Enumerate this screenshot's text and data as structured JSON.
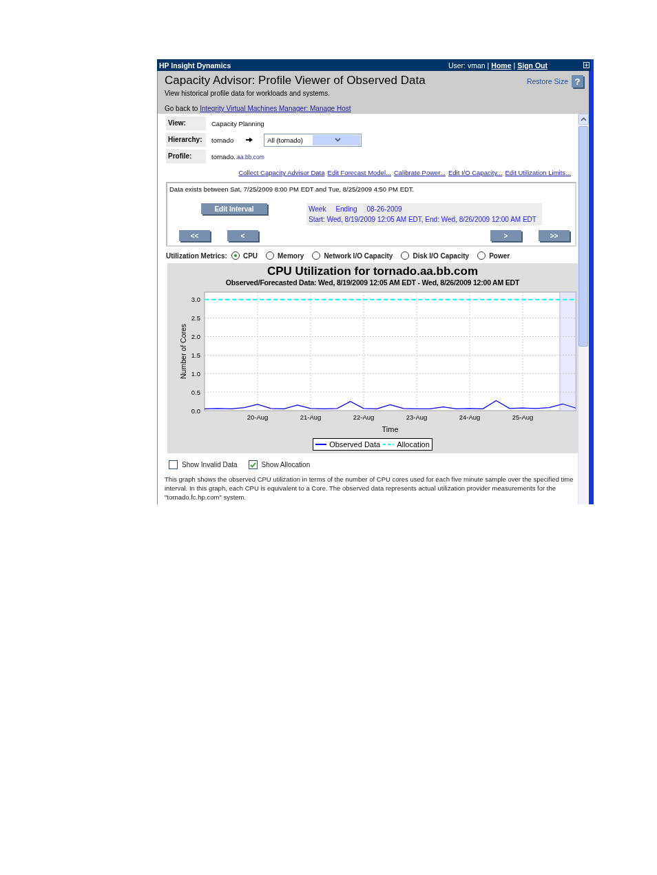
{
  "title_bar": {
    "app_name": "HP Insight Dynamics",
    "user": "User: vman",
    "links": [
      "Home",
      "Sign Out"
    ],
    "separator": "|"
  },
  "header": {
    "title": "Capacity Advisor: Profile Viewer of Observed Data",
    "subtitle": "View historical profile data for workloads and systems.",
    "restore_size": "Restore Size",
    "help": "?",
    "back_prefix": "Go back to",
    "back_link": "Integrity Virtual Machines Manager: Manage Host"
  },
  "properties": [
    {
      "kind": "text",
      "label": "View:",
      "value": "Capacity Planning"
    },
    {
      "kind": "hierarchy",
      "label": "Hierarchy:",
      "value": "tornado",
      "select_value": "All (tornado)"
    },
    {
      "kind": "profile",
      "label": "Profile:",
      "value": "tornado.",
      "value_suffix": ".aa.bb.com"
    }
  ],
  "actions": [
    "Collect Capacity Advisor Data",
    "Edit Forecast Model...",
    "Calibrate Power...",
    "Edit I/O Capacity...",
    "Edit Utilization Limits..."
  ],
  "interval": {
    "data_range": "Data exists between Sat, 7/25/2009 8:00 PM EDT and Tue, 8/25/2009 4:50 PM EDT.",
    "edit_button": "Edit Interval",
    "period": "Week",
    "ending_label": "Ending",
    "ending": "08-26-2009",
    "range": "Start: Wed, 8/19/2009 12:05 AM EDT, End: Wed, 8/26/2009 12:00 AM EDT",
    "nav_buttons": [
      "<<",
      "<",
      ">",
      ">>"
    ]
  },
  "metrics": {
    "label": "Utilization Metrics:",
    "options": [
      {
        "label": "CPU",
        "selected": true
      },
      {
        "label": "Memory",
        "selected": false
      },
      {
        "label": "Network I/O Capacity",
        "selected": false
      },
      {
        "label": "Disk I/O Capacity",
        "selected": false
      },
      {
        "label": "Power",
        "selected": false
      }
    ]
  },
  "chart": {
    "subtitle": "Observed/Forecasted Data: Wed, 8/19/2009 12:05 AM EDT - Wed, 8/26/2009 12:00 AM EDT",
    "chart_data": {
      "type": "line",
      "title": "CPU Utilization for tornado.aa.bb.com",
      "xlabel": "Time",
      "ylabel": "Number of Cores",
      "categories": [
        null,
        null,
        null,
        null,
        "20-Aug",
        null,
        null,
        null,
        "21-Aug",
        null,
        null,
        null,
        "22-Aug",
        null,
        null,
        null,
        "23-Aug",
        null,
        null,
        null,
        "24-Aug",
        null,
        null,
        null,
        "25-Aug",
        null,
        null,
        null,
        null
      ],
      "series": [
        {
          "name": "Observed Data",
          "color": "#0000ff",
          "line_style": "solid",
          "values": [
            0.05,
            0.06,
            0.05,
            0.08,
            0.17,
            0.06,
            0.05,
            0.15,
            0.06,
            0.05,
            0.06,
            0.25,
            0.06,
            0.05,
            0.16,
            0.06,
            0.05,
            0.05,
            0.1,
            0.05,
            0.06,
            0.05,
            0.27,
            0.06,
            0.07,
            0.06,
            0.08,
            0.18,
            0.07
          ]
        },
        {
          "name": "Allocation",
          "color": "#00ffff",
          "line_style": "dashed",
          "values": [
            3,
            3,
            3,
            3,
            3,
            3,
            3,
            3,
            3,
            3,
            3,
            3,
            3,
            3,
            3,
            3,
            3,
            3,
            3,
            3,
            3,
            3,
            3,
            3,
            3,
            3,
            3,
            3,
            3
          ]
        }
      ],
      "ylim": [
        0,
        3.2
      ],
      "yticks": [
        {
          "value": 0,
          "label": "0.0"
        },
        {
          "value": 0.5,
          "label": "0.5"
        },
        {
          "value": 1,
          "label": "1.0"
        },
        {
          "value": 1.5,
          "label": "1.5"
        },
        {
          "value": 2,
          "label": "2.0"
        },
        {
          "value": 2.5,
          "label": "2.5"
        },
        {
          "value": 3,
          "label": "3.0"
        }
      ],
      "grid": true
    },
    "forecast_shaded": true
  },
  "checkboxes": [
    {
      "label": "Show Invalid Data",
      "checked": false
    },
    {
      "label": "Show Allocation",
      "checked": true
    }
  ],
  "description": "This graph shows the observed CPU utilization in terms of the number of CPU cores used for each five minute sample over the specified time interval. In this graph, each CPU is equivalent to a Core. The observed data represents actual utilization provider measurements for the \"tornado.fc.hp.com\" system."
}
